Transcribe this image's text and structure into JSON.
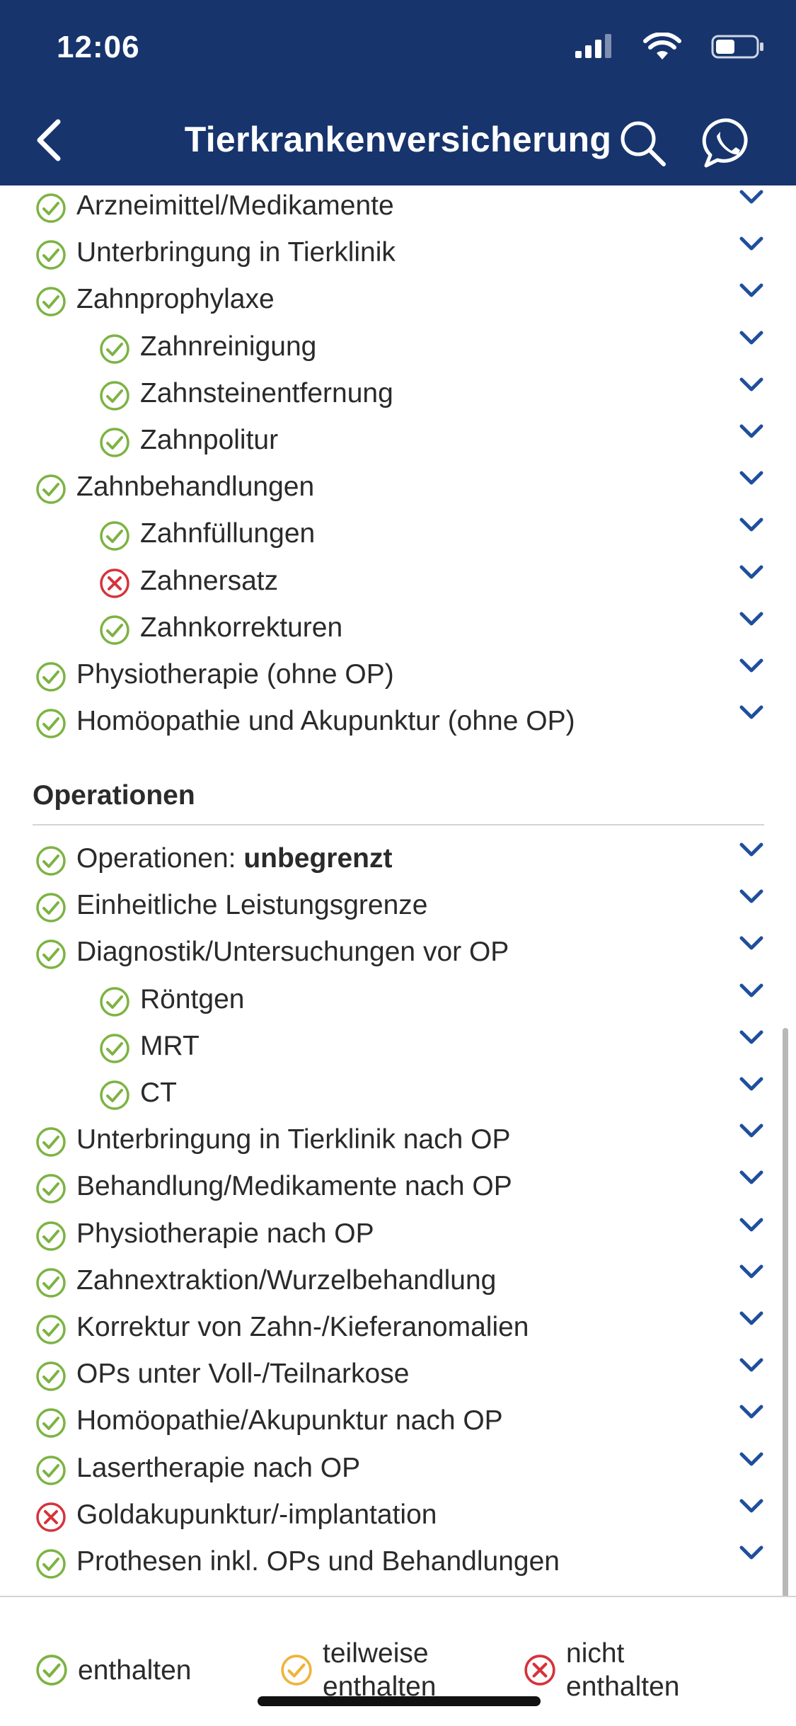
{
  "status_bar": {
    "time": "12:06"
  },
  "header": {
    "title": "Tierkrankenversicherung"
  },
  "items_top": [
    {
      "label": "Arzneimittel/Medikamente",
      "status": "included",
      "level": 1
    },
    {
      "label": "Unterbringung in Tierklinik",
      "status": "included",
      "level": 1
    },
    {
      "label": "Zahnprophylaxe",
      "status": "included",
      "level": 1
    },
    {
      "label": "Zahnreinigung",
      "status": "included",
      "level": 2
    },
    {
      "label": "Zahnsteinentfernung",
      "status": "included",
      "level": 2
    },
    {
      "label": "Zahnpolitur",
      "status": "included",
      "level": 2
    },
    {
      "label": "Zahnbehandlungen",
      "status": "included",
      "level": 1
    },
    {
      "label": "Zahnfüllungen",
      "status": "included",
      "level": 2
    },
    {
      "label": "Zahnersatz",
      "status": "excluded",
      "level": 2
    },
    {
      "label": "Zahnkorrekturen",
      "status": "included",
      "level": 2
    },
    {
      "label": "Physiotherapie (ohne OP)",
      "status": "included",
      "level": 1
    },
    {
      "label": "Homöopathie und Akupunktur (ohne OP)",
      "status": "included",
      "level": 1
    }
  ],
  "section": {
    "title": "Operationen",
    "first_item": {
      "label_prefix": "Operationen: ",
      "label_bold": "unbegrenzt",
      "status": "included",
      "level": 1
    },
    "items": [
      {
        "label": "Einheitliche Leistungsgrenze",
        "status": "included",
        "level": 1
      },
      {
        "label": "Diagnostik/Untersuchungen vor OP",
        "status": "included",
        "level": 1
      },
      {
        "label": "Röntgen",
        "status": "included",
        "level": 2
      },
      {
        "label": "MRT",
        "status": "included",
        "level": 2
      },
      {
        "label": "CT",
        "status": "included",
        "level": 2
      },
      {
        "label": "Unterbringung in Tierklinik nach OP",
        "status": "included",
        "level": 1
      },
      {
        "label": "Behandlung/Medikamente nach OP",
        "status": "included",
        "level": 1
      },
      {
        "label": "Physiotherapie nach OP",
        "status": "included",
        "level": 1
      },
      {
        "label": "Zahnextraktion/Wurzelbehandlung",
        "status": "included",
        "level": 1
      },
      {
        "label": "Korrektur von Zahn-/Kieferanomalien",
        "status": "included",
        "level": 1
      },
      {
        "label": "OPs unter Voll-/Teilnarkose",
        "status": "included",
        "level": 1
      },
      {
        "label": "Homöopathie/Akupunktur nach OP",
        "status": "included",
        "level": 1
      },
      {
        "label": "Lasertherapie nach OP",
        "status": "included",
        "level": 1
      },
      {
        "label": "Goldakupunktur/-implantation",
        "status": "excluded",
        "level": 1
      },
      {
        "label": "Prothesen inkl. OPs und Behandlungen",
        "status": "included",
        "level": 1
      }
    ]
  },
  "legend": {
    "included": "enthalten",
    "partial_line1": "teilweise",
    "partial_line2": "enthalten",
    "excluded_line1": "nicht",
    "excluded_line2": "enthalten"
  },
  "colors": {
    "header": "#17346d",
    "included": "#7cb342",
    "partial": "#f0b43c",
    "excluded": "#d6333b",
    "chevron": "#1f4f9c"
  },
  "icons": {
    "included": "check-circle-icon",
    "partial": "check-circle-icon",
    "excluded": "x-circle-icon",
    "expand": "chevron-down-icon"
  }
}
